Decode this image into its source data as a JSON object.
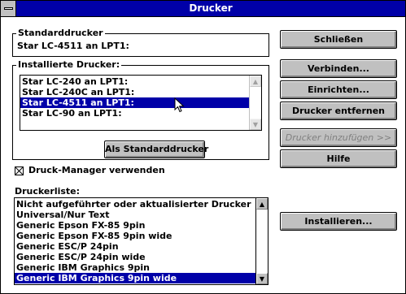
{
  "window": {
    "title": "Drucker"
  },
  "default_printer": {
    "label": "Standarddrucker",
    "value": "Star LC-4511 an LPT1:"
  },
  "installed": {
    "label": "Installierte Drucker:",
    "items": [
      "Star LC-240 an LPT1:",
      "Star LC-240C an LPT1:",
      "Star LC-4511 an LPT1:",
      "Star LC-90 an LPT1:"
    ],
    "selected_index": 2
  },
  "set_default_button": "Als Standarddrucker",
  "print_manager": {
    "label": "Druck-Manager verwenden",
    "checked": true
  },
  "printer_list": {
    "label": "Druckerliste:",
    "items": [
      "Nicht aufgeführter oder aktualisierter Drucker",
      "Universal/Nur Text",
      "Generic Epson FX-85 9pin",
      "Generic Epson FX-85 9pin wide",
      "Generic ESC/P 24pin",
      "Generic ESC/P 24pin wide",
      "Generic IBM Graphics 9pin",
      "Generic IBM Graphics 9pin wide"
    ],
    "selected_index": 7
  },
  "buttons": {
    "close": "Schließen",
    "connect": "Verbinden...",
    "setup": "Einrichten...",
    "remove": "Drucker entfernen",
    "add": "Drucker hinzufügen >>",
    "help": "Hilfe",
    "install": "Installieren..."
  },
  "icons": {
    "system_menu": "system-menu-icon",
    "scroll_up": "arrow-up-icon",
    "scroll_down": "arrow-down-icon",
    "checkbox_mark": "x-check-icon",
    "cursor": "mouse-pointer-icon"
  },
  "colors": {
    "titlebar": "#0000a8",
    "selection": "#0000a8",
    "button_face": "#c0c0c0"
  }
}
